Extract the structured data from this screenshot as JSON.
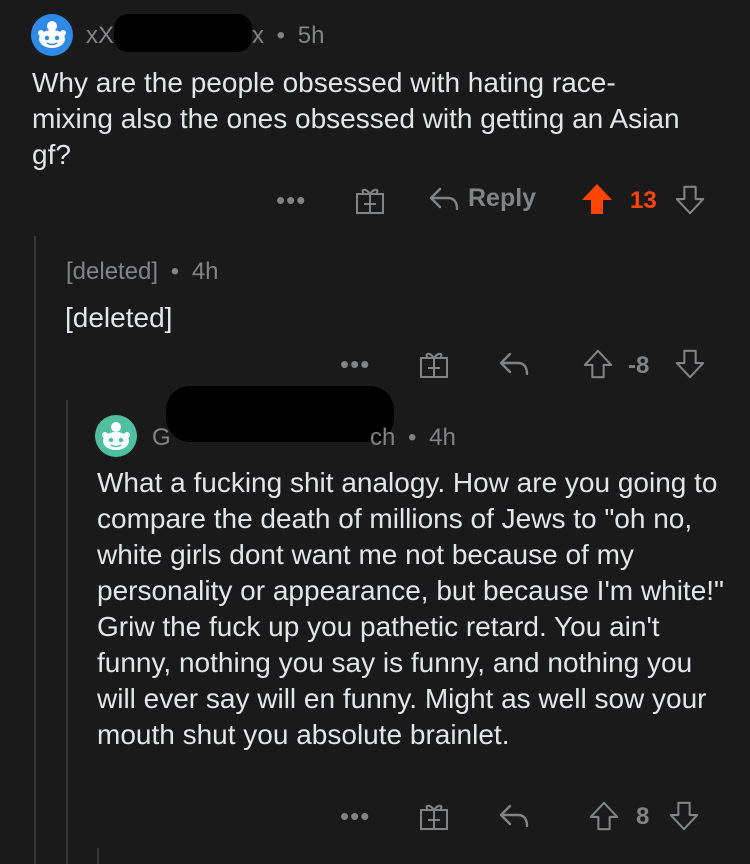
{
  "comment1": {
    "username_start": "xX",
    "username_end": "x",
    "age": "5h",
    "body": "Why are the people obsessed with hating race-mixing also the ones obsessed with getting an Asian gf?",
    "more": "•••",
    "reply_label": "Reply",
    "score": "13",
    "upvote_color": "#ff4500"
  },
  "comment2": {
    "username": "[deleted]",
    "age": "4h",
    "body": "[deleted]",
    "more": "•••",
    "score": "-8"
  },
  "comment3": {
    "username_start": "G",
    "username_end": "ch",
    "age": "4h",
    "body": "What a fucking shit analogy. How are you going to compare the death of millions of Jews to \"oh no, white girls dont want me not because of my personality or appearance, but because I'm white!\" Griw the fuck up you pathetic retard. You ain't funny, nothing you say is funny, and nothing you will ever say will en funny. Might as well sow your mouth shut you absolute brainlet.",
    "more": "•••",
    "score": "8"
  },
  "separator": "•"
}
